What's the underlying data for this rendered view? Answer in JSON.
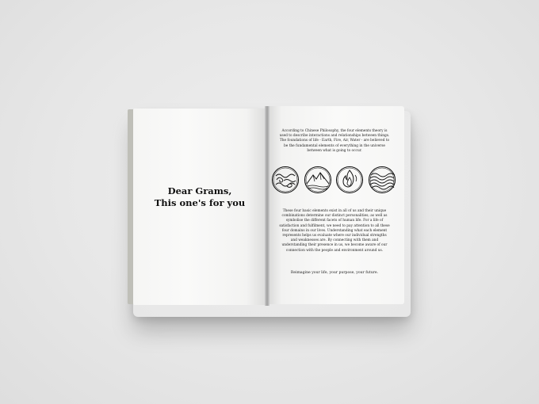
{
  "left_page": {
    "dedication_line1": "Dear Grams,",
    "dedication_line2": "This one's for you"
  },
  "right_page": {
    "intro_paragraph": "According to Chinese Philosophy, the four elements theory is used to describe interactions and relationships between things. The foundations of life - Earth, Fire, Air, Water - are believed to be the fundamental elements of everything in the universe between what is going to occur.",
    "body_paragraph": "These four basic elements exist in all of us and their unique combinations determine our distinct personalities; as well as symbolise the different facets of human life. For a life of satisfaction and fulfilment, we need to pay attention to all these four domains in our lives. Understanding what each element represents helps us evaluate where our individual strengths and weaknesses are. By connecting with them and understanding their presence in us, we become aware of our connection with the people and environment around us.",
    "tagline": "Reimagine your life, your purpose, your future.",
    "element_icons": [
      "air-icon",
      "earth-icon",
      "fire-icon",
      "water-icon"
    ]
  },
  "colors": {
    "background": "#e6e6e6",
    "paper": "#f8f8f7",
    "ink": "#111111"
  }
}
